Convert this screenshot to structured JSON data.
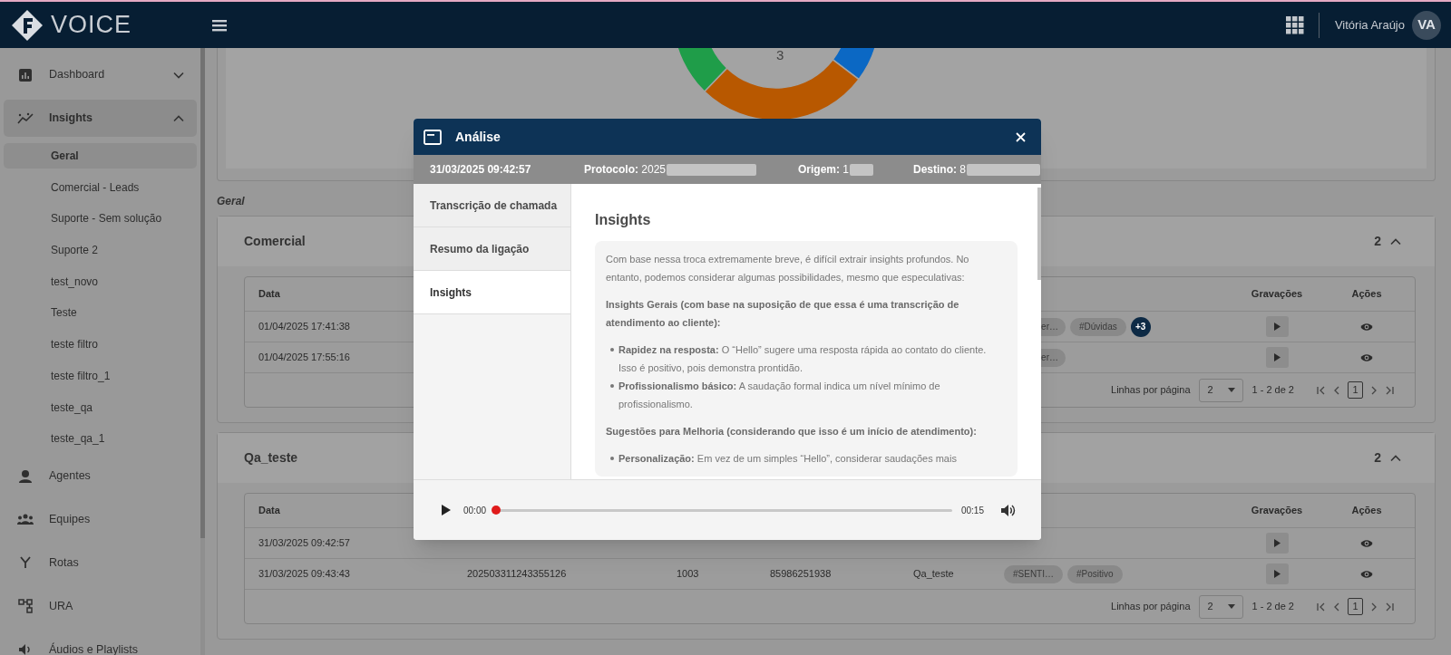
{
  "topbar": {
    "brand": "VOICE",
    "user": "Vitória Araújo",
    "avatar": "VA"
  },
  "sidebar": [
    {
      "label": "Dashboard",
      "expanded": false,
      "selected": false
    },
    {
      "label": "Insights",
      "expanded": true,
      "selected": true,
      "children": [
        {
          "label": "Geral",
          "selected": true
        },
        {
          "label": "Comercial - Leads",
          "selected": false
        },
        {
          "label": "Suporte - Sem solução",
          "selected": false
        },
        {
          "label": "Suporte 2",
          "selected": false
        },
        {
          "label": "test_novo",
          "selected": false
        },
        {
          "label": "Teste",
          "selected": false
        },
        {
          "label": "teste filtro",
          "selected": false
        },
        {
          "label": "teste filtro_1",
          "selected": false
        },
        {
          "label": "teste_qa",
          "selected": false
        },
        {
          "label": "teste_qa_1",
          "selected": false
        }
      ]
    },
    {
      "label": "Agentes",
      "selected": false
    },
    {
      "label": "Equipes",
      "selected": false
    },
    {
      "label": "Rotas",
      "selected": false
    },
    {
      "label": "URA",
      "selected": false
    },
    {
      "label": "Áudios e Playlists",
      "selected": false
    }
  ],
  "chart_card": {
    "donut_label": "3"
  },
  "group_label": "Geral",
  "sections": [
    {
      "title": "Comercial",
      "count": "2",
      "expanded": true,
      "columns": [
        "Data",
        "Gravações",
        "Ações"
      ],
      "rows": [
        {
          "date": "01/04/2025 17:41:38",
          "tags": [
            {
              "text": "er…",
              "partial": true
            },
            {
              "text": "#Dúvidas",
              "partial": false
            }
          ],
          "more": "+3"
        },
        {
          "date": "01/04/2025 17:55:16",
          "tags": [
            {
              "text": "er…",
              "partial": true
            }
          ]
        }
      ],
      "pagination": {
        "rows_label": "Linhas por página",
        "per_page": "2",
        "range": "1 - 2 de 2",
        "page": "1"
      }
    },
    {
      "title": "Qa_teste",
      "count": "2",
      "expanded": true,
      "columns": [
        "Data",
        "Gravações",
        "Ações"
      ],
      "rows": [
        {
          "date": "31/03/2025 09:42:57"
        },
        {
          "date": "31/03/2025 09:43:43",
          "protocol": "202503311243355126",
          "origin": "1003",
          "destination": "85986251938",
          "group": "Qa_teste",
          "tags": [
            {
              "text": "#SENTI…",
              "partial": false
            },
            {
              "text": "#Positivo",
              "partial": false
            }
          ]
        }
      ],
      "pagination": {
        "rows_label": "Linhas por página",
        "per_page": "2",
        "range": "1 - 2 de 2",
        "page": "1"
      }
    }
  ],
  "modal": {
    "title": "Análise",
    "date": "31/03/2025 09:42:57",
    "protocol": "**Protocolo:** 2025",
    "origin": "**Origem:** 1",
    "destination": "**Destino:** 8",
    "tabs": [
      {
        "label": "Transcrição de chamada",
        "selected": false
      },
      {
        "label": "Resumo da ligação",
        "selected": false
      },
      {
        "label": "Insights",
        "selected": true
      }
    ],
    "heading": "Insights",
    "blocks": [
      {
        "kind": "paragraph",
        "text": "Com base nessa troca extremamente breve, é difícil extrair insights profundos. No entanto, podemos considerar algumas possibilidades, mesmo que especulativas:"
      },
      {
        "kind": "heading",
        "text": "Insights Gerais (com base na suposição de que essa é uma transcrição de atendimento ao cliente):"
      },
      {
        "kind": "list",
        "items": [
          "**Rapidez na resposta:** O “Hello” sugere uma resposta rápida ao contato do cliente. Isso é positivo, pois demonstra prontidão.",
          "**Profissionalismo básico:** A saudação formal indica um nível mínimo de profissionalismo."
        ]
      },
      {
        "kind": "heading",
        "text": "Sugestões para Melhoria (considerando que isso é um início de atendimento):"
      },
      {
        "kind": "list",
        "items": [
          "**Personalização:** Em vez de um simples “Hello”, considerar saudações mais"
        ]
      }
    ],
    "player": {
      "current": "00:00",
      "duration": "00:15",
      "level": 0
    }
  }
}
